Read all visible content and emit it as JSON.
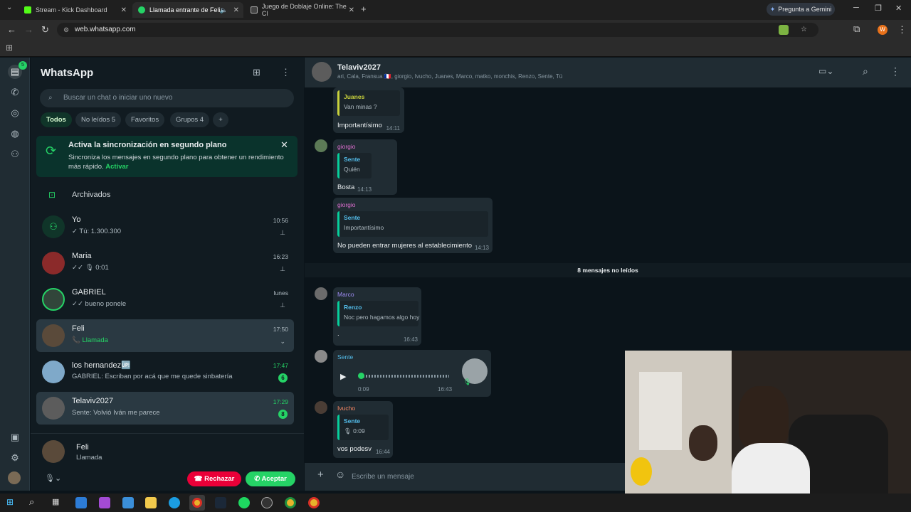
{
  "browser": {
    "tabs": [
      {
        "title": "Stream - Kick Dashboard"
      },
      {
        "title": "Llamada entrante de Feli"
      },
      {
        "title": "Juego de Doblaje Online: The Cl"
      }
    ],
    "gemini_label": "Pregunta a Gemini",
    "url": "web.whatsapp.com",
    "profile_letter": "W"
  },
  "rail": {
    "chats_badge": "5"
  },
  "sidebar": {
    "title": "WhatsApp",
    "search_placeholder": "Buscar un chat o iniciar uno nuevo",
    "filters": [
      "Todos",
      "No leídos 5",
      "Favoritos",
      "Grupos 4"
    ],
    "banner": {
      "title": "Activa la sincronización en segundo plano",
      "body": "Sincroniza los mensajes en segundo plano para obtener un rendimiento más rápido.",
      "link": "Activar"
    },
    "archived_label": "Archivados",
    "chats": [
      {
        "name": "Yo",
        "message": "✓ Tú: 1.300.300",
        "time": "10:56"
      },
      {
        "name": "Maria",
        "message": "✓✓ 🎙 0:01",
        "time": "16:23"
      },
      {
        "name": "GABRIEL",
        "message": "✓✓ bueno ponele",
        "time": "lunes"
      },
      {
        "name": "Feli",
        "message": "📞 Llamada",
        "time": "17:50"
      },
      {
        "name": "los hernandez🆙",
        "message": "GABRIEL: Escriban por acá que me quede sinbatería",
        "time": "17:47",
        "badge": "6"
      },
      {
        "name": "Telaviv2027",
        "message": "Sente: Volvió Iván me parece",
        "time": "17:29",
        "badge": "8"
      }
    ],
    "incoming_call": {
      "name": "Feli",
      "status": "Llamada",
      "reject_label": "Rechazar",
      "accept_label": "Aceptar"
    }
  },
  "conversation": {
    "title": "Telaviv2027",
    "members": "ari, Cala, Fransua 🇫🇷, giorgio, Ivucho, Juanes, Marco, matko, monchis, Renzo, Sente, Tú",
    "messages": [
      {
        "quote_name": "Juanes",
        "quote_text": "Van minas ?",
        "text": "Importantísimo",
        "time": "14:11"
      },
      {
        "sender": "giorgio",
        "quote_name": "Sente",
        "quote_text": "Quién",
        "text": "Bosta",
        "time": "14:13"
      },
      {
        "sender": "giorgio",
        "quote_name": "Sente",
        "quote_text": "Importantísimo",
        "text": "No pueden entrar mujeres al establecimiento",
        "time": "14:13"
      },
      {
        "sender": "Marco",
        "quote_name": "Renzo",
        "quote_text": "Noc pero hagamos algo hoy",
        "text": ".",
        "time": "16:43"
      },
      {
        "sender": "Sente",
        "voice_duration": "0:09",
        "time": "16:43"
      },
      {
        "sender": "Ivucho",
        "quote_name": "Sente",
        "quote_text": "🎙 0:09",
        "text": "vos podesv",
        "time": "16:44"
      }
    ],
    "unread_divider": "8 mensajes no leídos",
    "composer_placeholder": "Escribe un mensaje"
  }
}
